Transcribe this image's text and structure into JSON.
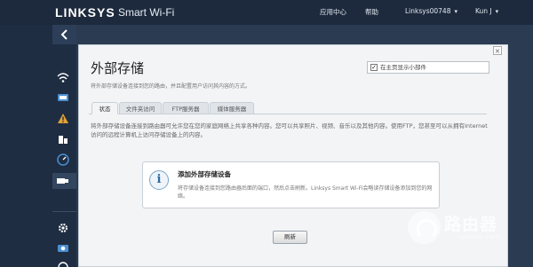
{
  "header": {
    "brand": "LINKSYS",
    "brand_sub": "Smart Wi-Fi",
    "nav": {
      "app_center": "应用中心",
      "help": "帮助",
      "router_name": "Linksys00748",
      "user": "Kun J"
    }
  },
  "rail": {
    "back_icon": "chevron-left-icon",
    "icons": [
      "network-icon",
      "devices-icon",
      "alert-icon",
      "parental-icon",
      "speed-icon",
      "usb-icon",
      "settings-icon",
      "camera-icon",
      "security-icon"
    ]
  },
  "panel": {
    "title": "外部存储",
    "subtitle": "将外部存储设备连接到您的路由，并且配置用户访问其内容的方式。",
    "show_on_home": "在主页显示小部件",
    "show_on_home_checked": true,
    "tabs": [
      "状态",
      "文件夹访问",
      "FTP服务器",
      "媒体服务器"
    ],
    "description": "将外部存储设备连接到路由器可允许您在您的家庭网络上共享各种内容。您可以共享照片、视频、音乐以及其他内容。使用FTP，您甚至可以从拥有Internet访问的远程计算机上访问存储设备上的内容。",
    "card": {
      "title": "添加外部存储设备",
      "text": "将存储设备连接到您路由器后面的端口，然后点击刷新。Linksys Smart Wi-Fi会略读存储设备添加到您的网络。"
    },
    "refresh_label": "刷新",
    "close_label": "×"
  },
  "watermark": {
    "name": "路由器",
    "url": "luyouqi.com"
  }
}
